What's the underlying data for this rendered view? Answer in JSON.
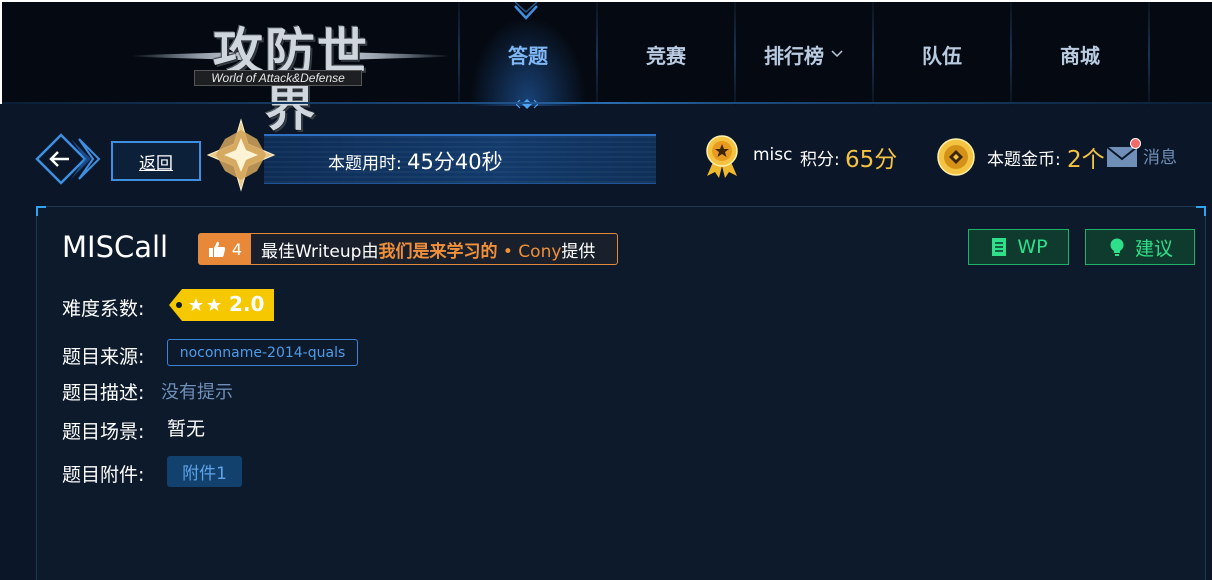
{
  "logo": {
    "title": "攻防世界",
    "subtitle": "World of Attack&Defense"
  },
  "nav": {
    "items": [
      {
        "label": "答题"
      },
      {
        "label": "竞赛"
      },
      {
        "label": "排行榜"
      },
      {
        "label": "队伍"
      },
      {
        "label": "商城"
      }
    ]
  },
  "status": {
    "back_label": "返回",
    "timer_label": "本题用时:",
    "timer_value": "45分40秒",
    "username": "misc",
    "score_label": "积分:",
    "score_value": "65分",
    "coin_label": "本题金币:",
    "coin_value": "2个",
    "message_label": "消息"
  },
  "challenge": {
    "title": "MISCall",
    "writeup": {
      "likes": "4",
      "prefix": "最佳Writeup由",
      "team": "我们是来学习的",
      "sep": " • ",
      "author": "Cony",
      "suffix": "提供"
    },
    "buttons": {
      "wp": "WP",
      "suggest": "建议"
    },
    "difficulty_label": "难度系数:",
    "difficulty_value": "2.0",
    "source_label": "题目来源:",
    "source_value": "noconname-2014-quals",
    "desc_label": "题目描述:",
    "desc_value": "没有提示",
    "scene_label": "题目场景:",
    "scene_value": "暂无",
    "attach_label": "题目附件:",
    "attach_value": "附件1"
  },
  "colors": {
    "accent_blue": "#3e8fe0",
    "gold": "#f5c342",
    "orange": "#f0903a",
    "green": "#2fe08a"
  }
}
